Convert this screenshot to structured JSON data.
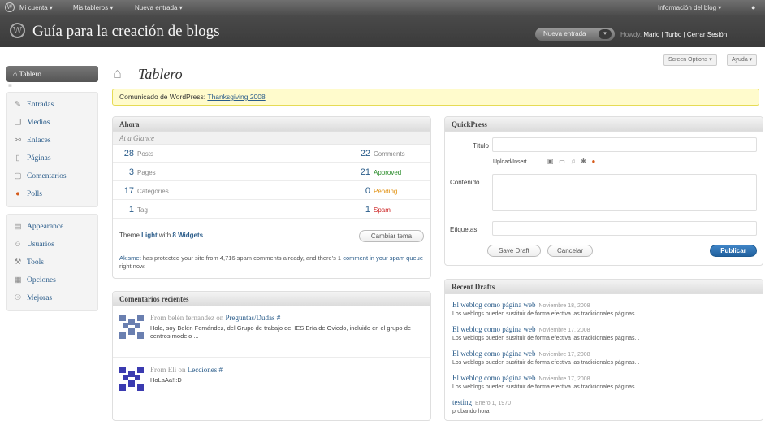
{
  "topbar": {
    "my_account": "Mi cuenta ▾",
    "my_blogs": "Mis tableros ▾",
    "new_post": "Nueva entrada ▾",
    "blog_info": "Información del blog ▾"
  },
  "header": {
    "site_name": "Guía para la creación de blogs",
    "new_entry_button": "Nueva entrada",
    "howdy": "Howdy,",
    "user_links": "Mario | Turbo | Cerrar Sesión"
  },
  "screen_options": "Screen Options ▾",
  "help": "Ayuda ▾",
  "sidebar": {
    "active": "Tablero",
    "group1": [
      {
        "icon": "pencil-icon",
        "glyph": "✎",
        "label": "Entradas"
      },
      {
        "icon": "media-icon",
        "glyph": "❏",
        "label": "Medios"
      },
      {
        "icon": "link-icon",
        "glyph": "⚯",
        "label": "Enlaces"
      },
      {
        "icon": "page-icon",
        "glyph": "▯",
        "label": "Páginas"
      },
      {
        "icon": "comment-icon",
        "glyph": "▢",
        "label": "Comentarios"
      },
      {
        "icon": "polls-icon",
        "glyph": "●",
        "label": "Polls"
      }
    ],
    "group2": [
      {
        "icon": "appearance-icon",
        "glyph": "▤",
        "label": "Appearance"
      },
      {
        "icon": "users-icon",
        "glyph": "☺",
        "label": "Usuarios"
      },
      {
        "icon": "tools-icon",
        "glyph": "⚒",
        "label": "Tools"
      },
      {
        "icon": "settings-icon",
        "glyph": "▦",
        "label": "Opciones"
      },
      {
        "icon": "upgrades-icon",
        "glyph": "☉",
        "label": "Mejoras"
      }
    ]
  },
  "page_title": "Tablero",
  "notice": {
    "prefix": "Comunicado de WordPress:",
    "link": "Thanksgiving 2008"
  },
  "ahora": {
    "title": "Ahora",
    "subtitle": "At a Glance",
    "rows": [
      {
        "n1": "28",
        "l1": "Posts",
        "n2": "22",
        "l2": "Comments",
        "c2": "#888888"
      },
      {
        "n1": "3",
        "l1": "Pages",
        "n2": "21",
        "l2": "Approved",
        "c2": "#2a8c2a"
      },
      {
        "n1": "17",
        "l1": "Categories",
        "n2": "0",
        "l2": "Pending",
        "c2": "#e08e0b"
      },
      {
        "n1": "1",
        "l1": "Tag",
        "n2": "1",
        "l2": "Spam",
        "c2": "#cc2222"
      }
    ],
    "theme_prefix": "Theme",
    "theme_name": "Light",
    "theme_with": "with",
    "widgets": "8 Widgets",
    "change_theme": "Cambiar tema",
    "akismet": "Akismet",
    "akismet_text": "has protected your site from 4,716 spam comments already, and there's 1",
    "spam_queue": "comment in your spam queue",
    "akismet_end": "right now."
  },
  "recent_comments": {
    "title": "Comentarios recientes",
    "items": [
      {
        "from": "From",
        "author": "belén fernandez",
        "on": "on",
        "post": "Preguntas/Dudas #",
        "text": "Hola, soy Belén Fernández, del Grupo de trabajo del IES Ería de Oviedo, incluido en el grupo de centros modelo ..."
      },
      {
        "from": "From",
        "author": "Eli",
        "on": "on",
        "post": "Lecciones #",
        "text": "HoLaAa!!:D"
      }
    ]
  },
  "quickpress": {
    "title": "QuickPress",
    "titulo_label": "Título",
    "upload_label": "Upload/Insert",
    "contenido_label": "Contenido",
    "etiquetas_label": "Etiquetas",
    "save_draft": "Save Draft",
    "cancel": "Cancelar",
    "publish": "Publicar"
  },
  "recent_drafts": {
    "title": "Recent Drafts",
    "items": [
      {
        "title": "El weblog como página web",
        "date": "Noviembre 18, 2008",
        "excerpt": "Los weblogs pueden sustituir de forma efectiva las tradicionales páginas..."
      },
      {
        "title": "El weblog como página web",
        "date": "Noviembre 17, 2008",
        "excerpt": "Los weblogs pueden sustituir de forma efectiva las tradicionales páginas..."
      },
      {
        "title": "El weblog como página web",
        "date": "Noviembre 17, 2008",
        "excerpt": "Los weblogs pueden sustituir de forma efectiva las tradicionales páginas..."
      },
      {
        "title": "El weblog como página web",
        "date": "Noviembre 17, 2008",
        "excerpt": "Los weblogs pueden sustituir de forma efectiva las tradicionales páginas..."
      },
      {
        "title": "testing",
        "date": "Enero 1, 1970",
        "excerpt": "probando hora"
      }
    ]
  }
}
